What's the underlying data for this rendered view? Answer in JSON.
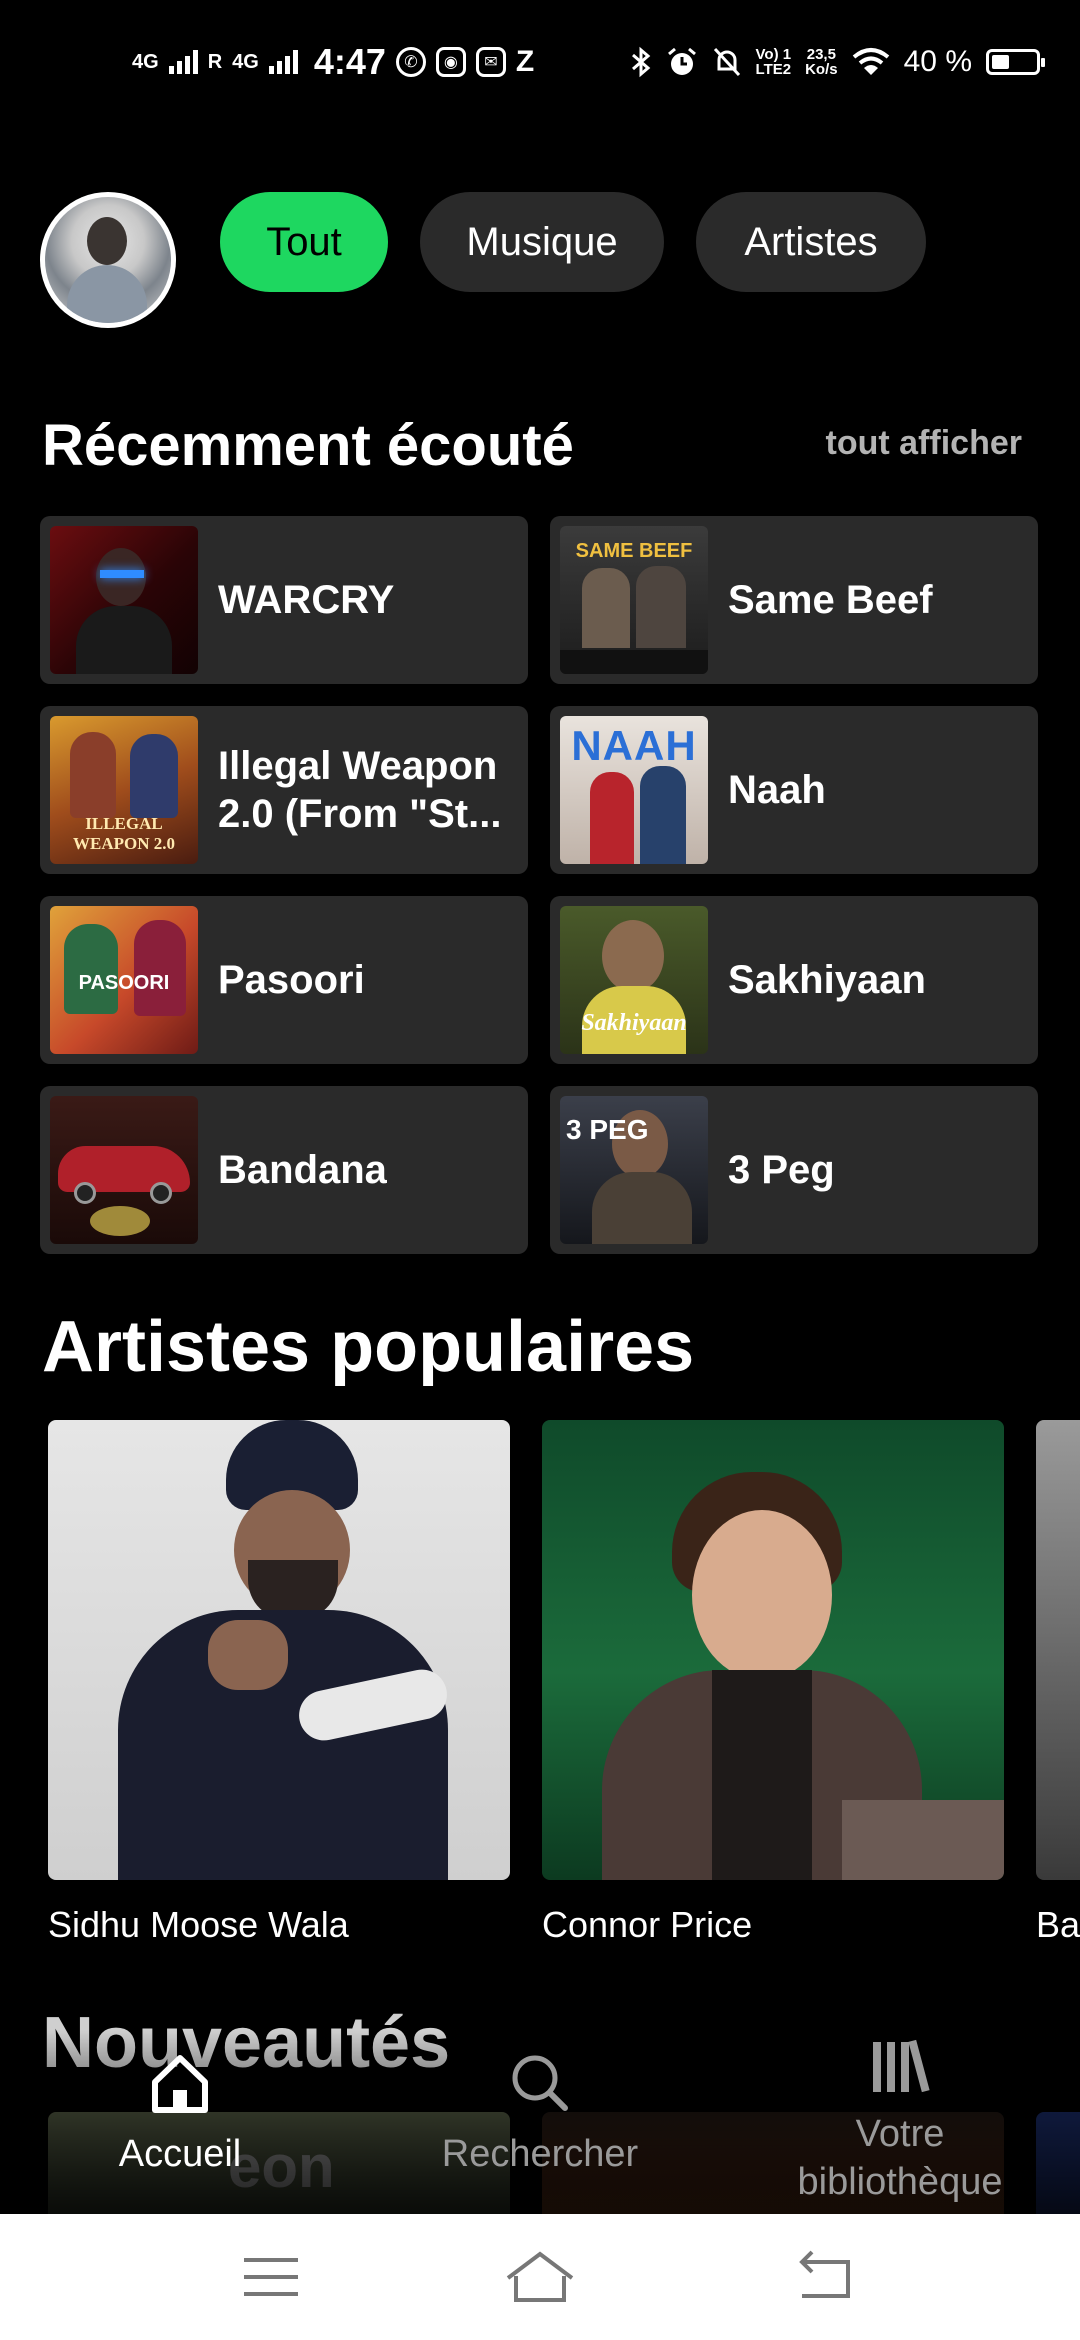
{
  "status_bar": {
    "sim1_label": "4G",
    "sim2_label": "4G",
    "roaming_label": "R",
    "time": "4:47",
    "app_z": "Z",
    "volte_line1": "Vo) 1",
    "volte_line2": "LTE2",
    "speed_value": "23,5",
    "speed_unit": "Ko/s",
    "battery_text": "40 %",
    "battery_level": 0.4
  },
  "header": {
    "chips": [
      {
        "label": "Tout",
        "active": true
      },
      {
        "label": "Musique",
        "active": false
      },
      {
        "label": "Artistes",
        "active": false
      }
    ]
  },
  "recent": {
    "title": "Récemment écouté",
    "see_all": "tout afficher",
    "items": [
      {
        "title": "WARCRY"
      },
      {
        "title": "Same Beef"
      },
      {
        "title": "Illegal Weapon 2.0 (From \"St..."
      },
      {
        "title": "Naah"
      },
      {
        "title": "Pasoori"
      },
      {
        "title": "Sakhiyaan"
      },
      {
        "title": "Bandana"
      },
      {
        "title": "3 Peg"
      }
    ],
    "cover_texts": {
      "same_beef": "SAME BEEF",
      "illegal_weapon": "ILLEGAL WEAPON 2.0",
      "naah": "NAAH",
      "pasoori": "PASOORI",
      "sakhiyaan": "Sakhiyaan",
      "three_peg": "3 PEG"
    }
  },
  "artists": {
    "title": "Artistes populaires",
    "items": [
      {
        "name": "Sidhu Moose Wala"
      },
      {
        "name": "Connor Price"
      },
      {
        "name": "Ba"
      }
    ]
  },
  "new_releases": {
    "title": "Nouveautés",
    "first_cover_text": "eon"
  },
  "bottom_nav": {
    "items": [
      {
        "label": "Accueil",
        "icon": "home-icon",
        "active": true
      },
      {
        "label": "Rechercher",
        "icon": "search-icon",
        "active": false
      },
      {
        "label": "Votre bibliothèque",
        "icon": "library-icon",
        "active": false
      }
    ]
  },
  "system_nav": {
    "icons": [
      "menu-icon",
      "home-icon",
      "back-icon"
    ]
  },
  "colors": {
    "accent": "#1ed760",
    "background": "#000000",
    "card": "#2a2a2a",
    "muted_text": "#b3b3b3"
  }
}
